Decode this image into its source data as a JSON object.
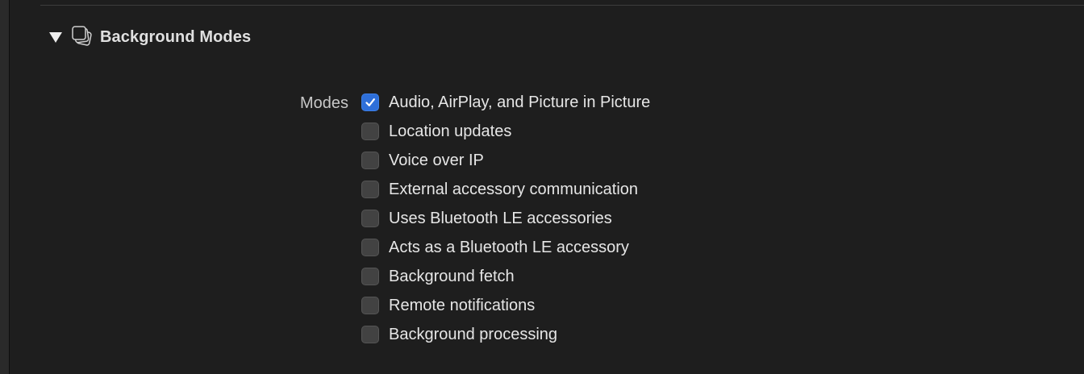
{
  "section": {
    "title": "Background Modes",
    "icon": "background-modes-icon",
    "expanded": true
  },
  "modes": {
    "label": "Modes",
    "items": [
      {
        "label": "Audio, AirPlay, and Picture in Picture",
        "checked": true
      },
      {
        "label": "Location updates",
        "checked": false
      },
      {
        "label": "Voice over IP",
        "checked": false
      },
      {
        "label": "External accessory communication",
        "checked": false
      },
      {
        "label": "Uses Bluetooth LE accessories",
        "checked": false
      },
      {
        "label": "Acts as a Bluetooth LE accessory",
        "checked": false
      },
      {
        "label": "Background fetch",
        "checked": false
      },
      {
        "label": "Remote notifications",
        "checked": false
      },
      {
        "label": "Background processing",
        "checked": false
      }
    ]
  },
  "colors": {
    "background": "#1e1e1e",
    "checkbox_checked": "#2e6fd9",
    "checkbox_unchecked": "#424242",
    "text": "#e6e6e6"
  }
}
